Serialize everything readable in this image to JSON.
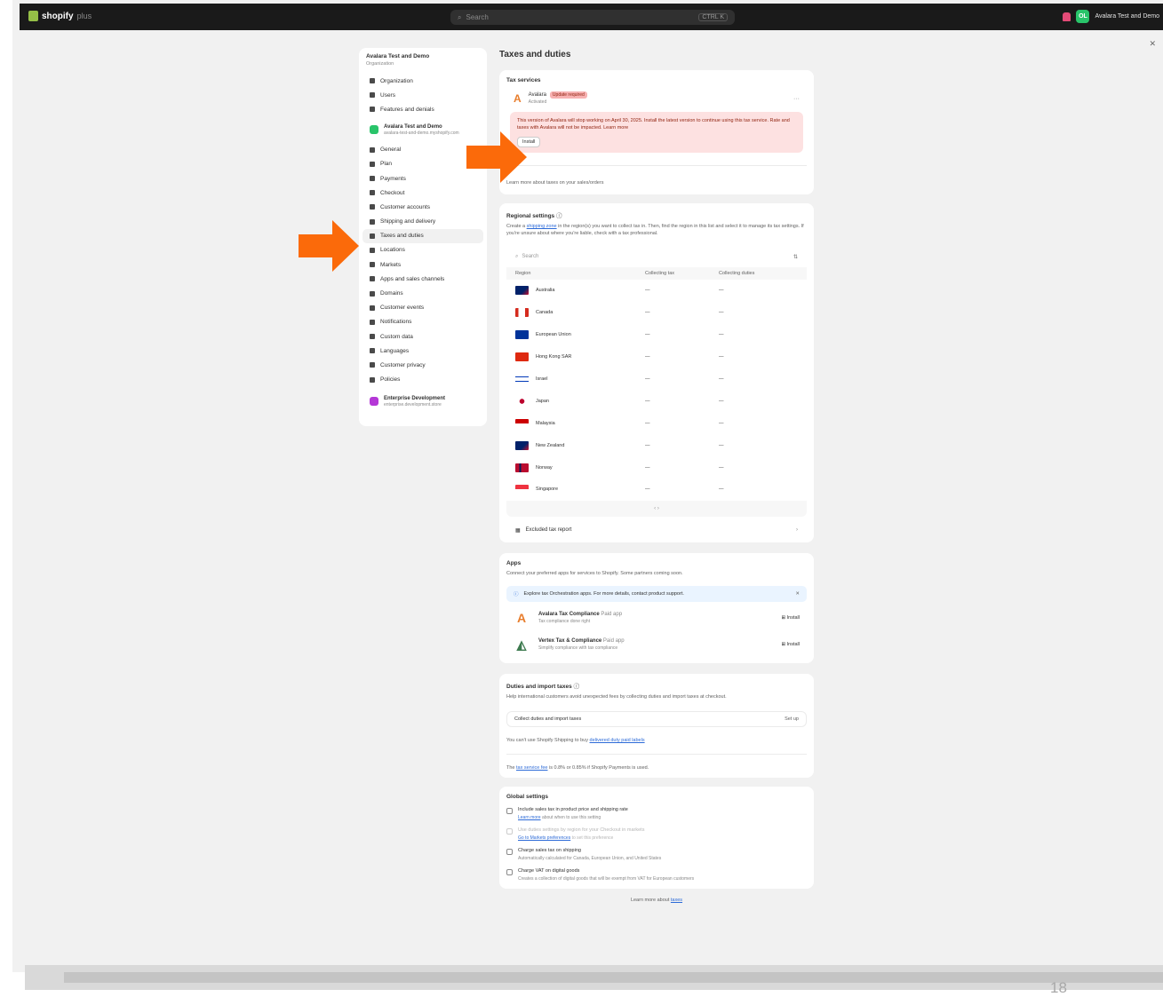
{
  "topbar": {
    "brand": "shopify",
    "brand_suffix": "plus",
    "search_placeholder": "Search",
    "search_shortcut": "CTRL K",
    "avatar_initials": "OL",
    "store_name": "Avalara Test and Demo"
  },
  "sidebar": {
    "store": "Avalara Test and Demo",
    "store_sub": "Organization",
    "group1": [
      "Organization",
      "Users",
      "Features and denials"
    ],
    "app1": {
      "name": "Avalara Test and Demo",
      "sub": "avalara-test-and-demo.myshopify.com"
    },
    "group2": [
      "General",
      "Plan",
      "Payments",
      "Checkout",
      "Customer accounts",
      "Shipping and delivery",
      "Taxes and duties",
      "Locations",
      "Markets",
      "Apps and sales channels",
      "Domains",
      "Customer events",
      "Notifications",
      "Custom data",
      "Languages",
      "Customer privacy",
      "Policies"
    ],
    "app2": {
      "name": "Enterprise Development",
      "sub": "enterprise.development.store"
    }
  },
  "main": {
    "title": "Taxes and duties",
    "tax_service": {
      "heading": "Tax services",
      "service_name": "Avalara",
      "badge": "Update required",
      "status": "Activated",
      "alert_text": "This version of Avalara will stop working on April 30, 2025. Install the latest version to continue using this tax service. Rate and taxes with Avalara will not be impacted. Learn more",
      "alert_button": "Install",
      "footer": "Learn more about taxes on your sales/orders"
    },
    "regional": {
      "heading": "Regional settings",
      "desc_pre": "Create a",
      "desc_link": "shipping zone",
      "desc_post": "in the region(s) you want to collect tax in. Then, find the region in this list and select it to manage its tax settings. If you're unsure about where you're liable, check with a tax professional.",
      "search_placeholder": "Search",
      "col_region": "Region",
      "col_collecting": "Collecting tax",
      "col_duties": "Collecting duties",
      "rows": [
        {
          "name": "Australia",
          "tax": "—",
          "duty": "—"
        },
        {
          "name": "Canada",
          "tax": "—",
          "duty": "—"
        },
        {
          "name": "European Union",
          "tax": "—",
          "duty": "—"
        },
        {
          "name": "Hong Kong SAR",
          "tax": "—",
          "duty": "—"
        },
        {
          "name": "Israel",
          "tax": "—",
          "duty": "—"
        },
        {
          "name": "Japan",
          "tax": "—",
          "duty": "—"
        },
        {
          "name": "Malaysia",
          "tax": "—",
          "duty": "—"
        },
        {
          "name": "New Zealand",
          "tax": "—",
          "duty": "—"
        },
        {
          "name": "Norway",
          "tax": "—",
          "duty": "—"
        },
        {
          "name": "Singapore",
          "tax": "—",
          "duty": "—"
        }
      ],
      "pager": "‹  ›",
      "excluded": "Excluded tax report"
    },
    "apps": {
      "heading": "Apps",
      "desc": "Connect your preferred apps for services to Shopify. Some partners coming soon.",
      "info": "Explore tax Orchestration apps. For more details, contact product support.",
      "items": [
        {
          "name": "Avalara Tax Compliance",
          "tag": "Paid app",
          "desc": "Tax compliance done right",
          "action": "Install"
        },
        {
          "name": "Vertex Tax & Compliance",
          "tag": "Paid app",
          "desc": "Simplify compliance with tax compliance",
          "action": "Install"
        }
      ]
    },
    "duties": {
      "heading": "Duties and import taxes",
      "desc": "Help international customers avoid unexpected fees by collecting duties and import taxes at checkout.",
      "box_label": "Collect duties and import taxes",
      "box_action": "Set up",
      "note_pre": "You can't use Shopify Shipping to buy",
      "note_link": "delivered duty paid labels",
      "rate_pre": "The",
      "rate_link": "tax service fee",
      "rate_post": "is 0.8% or 0.85% if Shopify Payments is used."
    },
    "global": {
      "heading": "Global settings",
      "items": [
        {
          "label": "Include sales tax in product price and shipping rate",
          "hint_link": "Learn more",
          "hint": "about when to use this setting",
          "disabled": false
        },
        {
          "label": "Use duties settings by region for your Checkout in markets",
          "hint_link": "Go to Markets preferences",
          "hint": "to set this preference",
          "disabled": true
        },
        {
          "label": "Charge sales tax on shipping",
          "hint_link": "",
          "hint": "Automatically calculated for Canada, European Union, and United States",
          "disabled": false
        },
        {
          "label": "Charge VAT on digital goods",
          "hint_link": "",
          "hint": "Creates a collection of digital goods that will be exempt from VAT for European customers",
          "disabled": false
        }
      ]
    },
    "learn_pre": "Learn more about",
    "learn_link": "taxes"
  },
  "page_number": "18",
  "colors": {
    "arrow": "#fb6a0a",
    "alert_bg": "#fde1e1",
    "topbar": "#1a1a1a"
  }
}
